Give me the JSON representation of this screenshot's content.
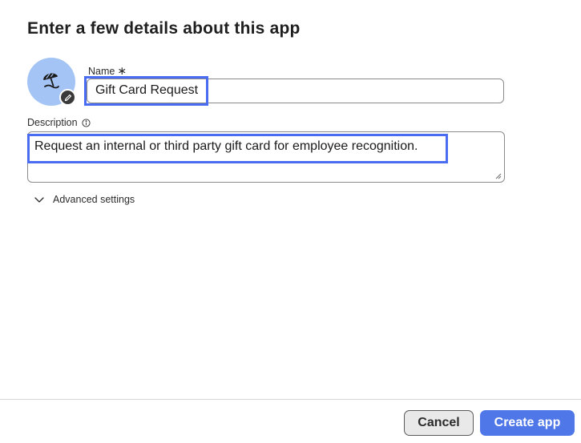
{
  "dialog": {
    "title": "Enter a few details about this app"
  },
  "app_icon": {
    "icon": "beach-umbrella-icon",
    "background_color": "#a3c4f5",
    "edit_icon": "pencil-icon"
  },
  "form": {
    "name": {
      "label": "Name",
      "required_mark": "∗",
      "value": "Gift Card Request"
    },
    "description": {
      "label": "Description",
      "info_icon": "info-icon",
      "value": "Request an internal or third party gift card for employee recognition."
    },
    "advanced": {
      "label": "Advanced settings",
      "icon": "chevron-down-icon"
    }
  },
  "footer": {
    "cancel_label": "Cancel",
    "create_label": "Create app"
  },
  "colors": {
    "highlight": "#4a6cf0",
    "primary_button": "#4f77e8"
  }
}
